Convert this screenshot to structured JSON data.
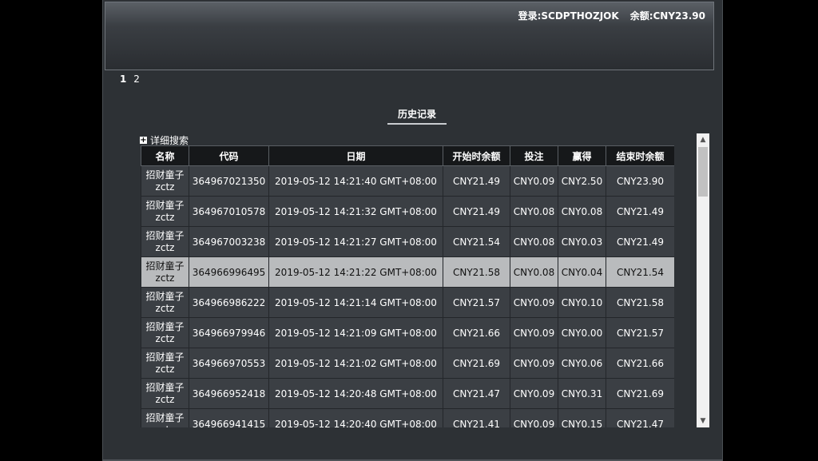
{
  "header": {
    "login_label": "登录:",
    "username": "SCDPTHOZJOK",
    "balance_label": "余额:",
    "balance": "CNY23.90"
  },
  "pager": {
    "pages": [
      "1",
      "2"
    ],
    "active": "1"
  },
  "tab": {
    "title": "历史记录"
  },
  "search": {
    "label": "详细搜索",
    "icon": "plus-icon"
  },
  "table": {
    "columns": [
      "名称",
      "代码",
      "日期",
      "开始时余额",
      "投注",
      "赢得",
      "结束时余额"
    ],
    "rows": [
      {
        "name": "招财童子",
        "sub": "zctz",
        "code": "364967021350",
        "date": "2019-05-12 14:21:40 GMT+08:00",
        "start": "CNY21.49",
        "bet": "CNY0.09",
        "win": "CNY2.50",
        "end": "CNY23.90"
      },
      {
        "name": "招财童子",
        "sub": "zctz",
        "code": "364967010578",
        "date": "2019-05-12 14:21:32 GMT+08:00",
        "start": "CNY21.49",
        "bet": "CNY0.08",
        "win": "CNY0.08",
        "end": "CNY21.49"
      },
      {
        "name": "招财童子",
        "sub": "zctz",
        "code": "364967003238",
        "date": "2019-05-12 14:21:27 GMT+08:00",
        "start": "CNY21.54",
        "bet": "CNY0.08",
        "win": "CNY0.03",
        "end": "CNY21.49"
      },
      {
        "name": "招财童子",
        "sub": "zctz",
        "code": "364966996495",
        "date": "2019-05-12 14:21:22 GMT+08:00",
        "start": "CNY21.58",
        "bet": "CNY0.08",
        "win": "CNY0.04",
        "end": "CNY21.54"
      },
      {
        "name": "招财童子",
        "sub": "zctz",
        "code": "364966986222",
        "date": "2019-05-12 14:21:14 GMT+08:00",
        "start": "CNY21.57",
        "bet": "CNY0.09",
        "win": "CNY0.10",
        "end": "CNY21.58"
      },
      {
        "name": "招财童子",
        "sub": "zctz",
        "code": "364966979946",
        "date": "2019-05-12 14:21:09 GMT+08:00",
        "start": "CNY21.66",
        "bet": "CNY0.09",
        "win": "CNY0.00",
        "end": "CNY21.57"
      },
      {
        "name": "招财童子",
        "sub": "zctz",
        "code": "364966970553",
        "date": "2019-05-12 14:21:02 GMT+08:00",
        "start": "CNY21.69",
        "bet": "CNY0.09",
        "win": "CNY0.06",
        "end": "CNY21.66"
      },
      {
        "name": "招财童子",
        "sub": "zctz",
        "code": "364966952418",
        "date": "2019-05-12 14:20:48 GMT+08:00",
        "start": "CNY21.47",
        "bet": "CNY0.09",
        "win": "CNY0.31",
        "end": "CNY21.69"
      },
      {
        "name": "招财童子",
        "sub": "zctz",
        "code": "364966941415",
        "date": "2019-05-12 14:20:40 GMT+08:00",
        "start": "CNY21.41",
        "bet": "CNY0.09",
        "win": "CNY0.15",
        "end": "CNY21.47"
      }
    ]
  }
}
